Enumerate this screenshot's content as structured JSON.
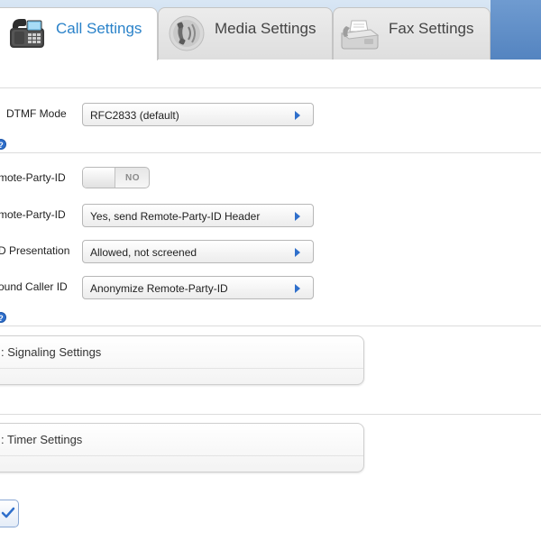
{
  "tabs": [
    {
      "label": "Call Settings",
      "icon": "desk-phone-icon",
      "active": true
    },
    {
      "label": "Media Settings",
      "icon": "phone-handset-icon",
      "active": false
    },
    {
      "label": "Fax Settings",
      "icon": "fax-machine-icon",
      "active": false
    }
  ],
  "dtmf": {
    "label": "DTMF Mode",
    "value": "RFC2833 (default)"
  },
  "remote_party": {
    "toggle_label": "mote-Party-ID",
    "toggle_value": "NO",
    "send_label": "mote-Party-ID",
    "send_value": "Yes, send Remote-Party-ID Header",
    "presentation_label": "D Presentation",
    "presentation_value": "Allowed, not screened",
    "outbound_label": "ound Caller ID",
    "outbound_value": "Anonymize Remote-Party-ID"
  },
  "help_glyph": "?",
  "panels": [
    {
      "title": ": Signaling Settings"
    },
    {
      "title": ": Timer Settings"
    }
  ],
  "colors": {
    "accent": "#2a82c9",
    "help_blue": "#2f6fcb",
    "tab_bar": "#c2d7ec",
    "tab_bar_dark": "#5484c0"
  },
  "apply_icon": "checkmark-icon"
}
